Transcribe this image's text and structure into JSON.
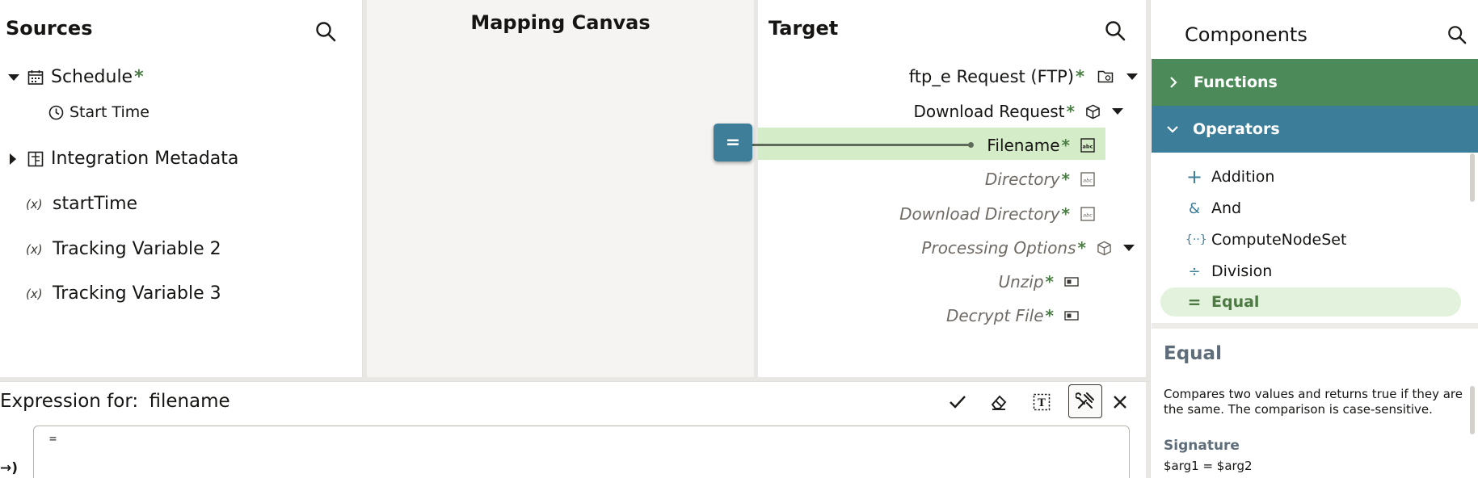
{
  "sources": {
    "title": "Sources",
    "items": [
      {
        "label": "Schedule",
        "required": "*"
      },
      {
        "label": "Start Time"
      },
      {
        "label": "Integration Metadata"
      },
      {
        "label": "startTime",
        "badge": "(x)"
      },
      {
        "label": "Tracking Variable 2",
        "badge": "(x)"
      },
      {
        "label": "Tracking Variable 3",
        "badge": "(x)"
      }
    ]
  },
  "canvas": {
    "title": "Mapping Canvas",
    "node_label": "="
  },
  "target": {
    "title": "Target",
    "items": [
      {
        "label": "ftp_e Request (FTP)",
        "required": "*"
      },
      {
        "label": "Download Request",
        "required": "*"
      },
      {
        "label": "Filename",
        "required": "*"
      },
      {
        "label": "Directory",
        "required": "*"
      },
      {
        "label": "Download Directory",
        "required": "*"
      },
      {
        "label": "Processing Options",
        "required": "*"
      },
      {
        "label": "Unzip",
        "required": "*"
      },
      {
        "label": "Decrypt File",
        "required": "*"
      }
    ]
  },
  "components": {
    "title": "Components",
    "sections": [
      {
        "label": "Functions",
        "color": "#4d8a5a"
      },
      {
        "label": "Operators",
        "color": "#3c7d99"
      }
    ],
    "operators": [
      {
        "label": "Addition",
        "icon": "+"
      },
      {
        "label": "And",
        "icon": "&"
      },
      {
        "label": "ComputeNodeSet",
        "icon": "{··}"
      },
      {
        "label": "Division",
        "icon": "÷"
      },
      {
        "label": "Equal",
        "icon": "="
      }
    ],
    "detail": {
      "title": "Equal",
      "description": "Compares two values and returns true if they are the same. The comparison is case-sensitive.",
      "signature_label": "Signature",
      "signature": "$arg1 = $arg2"
    }
  },
  "expression": {
    "label": "Expression for:",
    "field": "filename",
    "editor_value": "=",
    "left_glyph": "→)"
  },
  "colors": {
    "accent_green": "#4d8a5a",
    "accent_blue": "#3c7d99",
    "mapped_highlight": "#d5ecc9",
    "selected_op": "#e2f2dc"
  }
}
